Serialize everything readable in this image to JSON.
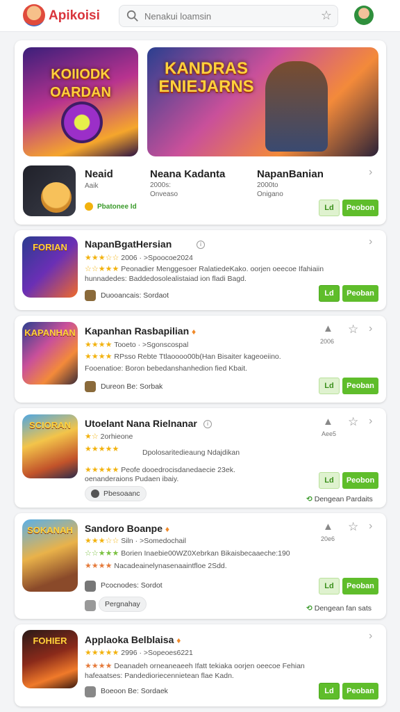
{
  "header": {
    "brand": "Apikoisi",
    "search_placeholder": "Nenakui loamsin"
  },
  "featured": {
    "banner1_title": "KOIIODK\nOARDAN",
    "banner2_title": "KANDRAS\nENIEJARNS",
    "apps": [
      {
        "name": "Neaid",
        "sub1": "Aaik"
      },
      {
        "name": "Neana Kadanta",
        "sub1": "2000s:",
        "sub2": "Onveaso"
      },
      {
        "name": "NapanBanian",
        "sub1": "2000to",
        "sub2": "Onigano"
      }
    ],
    "rating_label": "Pbatonee Id",
    "btn_small": "Ld",
    "btn_main": "Peobon"
  },
  "list": [
    {
      "icon_text": "FORIAN",
      "title": "NapanBgatHersian",
      "line1": "2006 · >Spoocoe2024",
      "line2": "Peonadier Menggesoer RalatiedeKako. oorjen oeecoe Ifahiaiin",
      "line3": "hunnadedes: Baddedosolealistaiad ion fladi Bagd.",
      "dev": "Duooancais: Sordaot",
      "btn_small": "Ld",
      "btn_main": "Peoban"
    },
    {
      "icon_text": "KAPANHAN",
      "title": "Kapanhan Rasbapilian",
      "line1": "Tooeto · >Sgonscospal",
      "line2": "RPsso Rebte Ttlaoooo00b(Han Bisaiter kageoeiino.",
      "line3": "Fooenatioe: Boron bebedanshanhedion fied Kbait.",
      "dev": "Dureon Be: Sorbak",
      "count": "2006",
      "btn_small": "Ld",
      "btn_main": "Peoban"
    },
    {
      "icon_text": "SCIORAN",
      "title": "Utoelant Nana Rielnanar",
      "line1": "2orhieone",
      "line2": "Dpolosaritedieaung Ndajdikan",
      "line3": "Peofe dooedrocisdanedaecie 23ek.",
      "line4": "oenanderaions Pudaen ibaiy.",
      "dev": "Pbesoaanc",
      "count": "Aee5",
      "btn_small": "Ld",
      "btn_main": "Peobon",
      "link": "Dengean Pardaits"
    },
    {
      "icon_text": "SOKANAH",
      "title": "Sandoro Boanpe",
      "line1": "Siln · >Somedochail",
      "line2": "Borien Inaebie00WZ0Xebrkan Bikaisbecaaeche:190",
      "line3": "Nacadeainelynasenaaintfloe 2Sdd.",
      "dev": "Pcocnodes: Sordot",
      "pill": "Pergnahay",
      "count": "20e6",
      "btn_small": "Ld",
      "btn_main": "Peoban",
      "link": "Dengean fan sats"
    },
    {
      "icon_text": "FOHIER",
      "title": "Applaoka Belblaisa",
      "line1": "2996 · >Sopeoes6221",
      "line2": "Deanadeh orneaneaeeh Ifatt tekiaka oorjen oeecoe Fehian",
      "line3": "hafeaatses: Pandedioriecennietean flae Kadn.",
      "dev": "Boeoon Be: Sordaek",
      "btn_small": "Ld",
      "btn_main": "Peoban"
    }
  ],
  "colors": {
    "brand_red": "#d9343c",
    "action_green": "#5fbd2b",
    "star_gold": "#f2b20e"
  }
}
